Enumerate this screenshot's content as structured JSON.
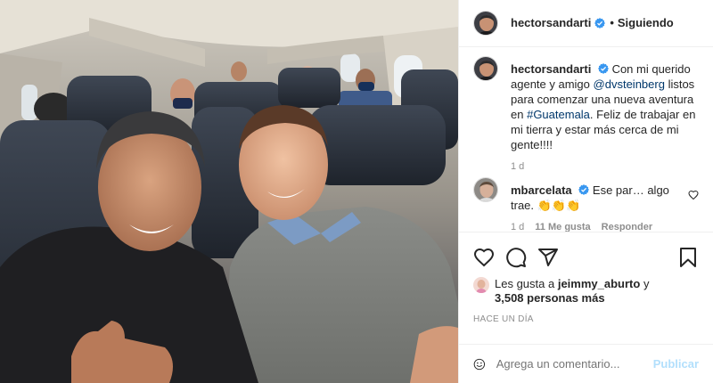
{
  "header": {
    "username": "hectorsandarti",
    "separator": "•",
    "follow_state": "Siguiendo"
  },
  "caption": {
    "username": "hectorsandarti",
    "text_before": "Con mi querido agente y amigo",
    "mention": "@dvsteinberg",
    "text_mid": "listos para comenzar una nueva aventura en",
    "hashtag": "#Guatemala",
    "text_after": ". Feliz de trabajar en mi tierra y estar más cerca de mi gente!!!!",
    "time": "1 d"
  },
  "comment": {
    "username": "mbarcelata",
    "text": "Ese par… algo trae. 👏👏👏",
    "time": "1 d",
    "likes": "11 Me gusta",
    "reply": "Responder"
  },
  "likes": {
    "prefix": "Les gusta a",
    "user": "jeimmy_aburto",
    "conj": "y",
    "others": "3,508 personas más"
  },
  "date": "HACE UN DÍA",
  "add_comment": {
    "placeholder": "Agrega un comentario...",
    "publish": "Publicar"
  },
  "colors": {
    "verified": "#3897f0",
    "link": "#00376b",
    "publish_disabled": "#b2dffc",
    "muted": "#8e8e8e"
  },
  "icons": [
    "heart-icon",
    "comment-icon",
    "share-icon",
    "bookmark-icon",
    "emoji-icon",
    "verified-icon"
  ]
}
